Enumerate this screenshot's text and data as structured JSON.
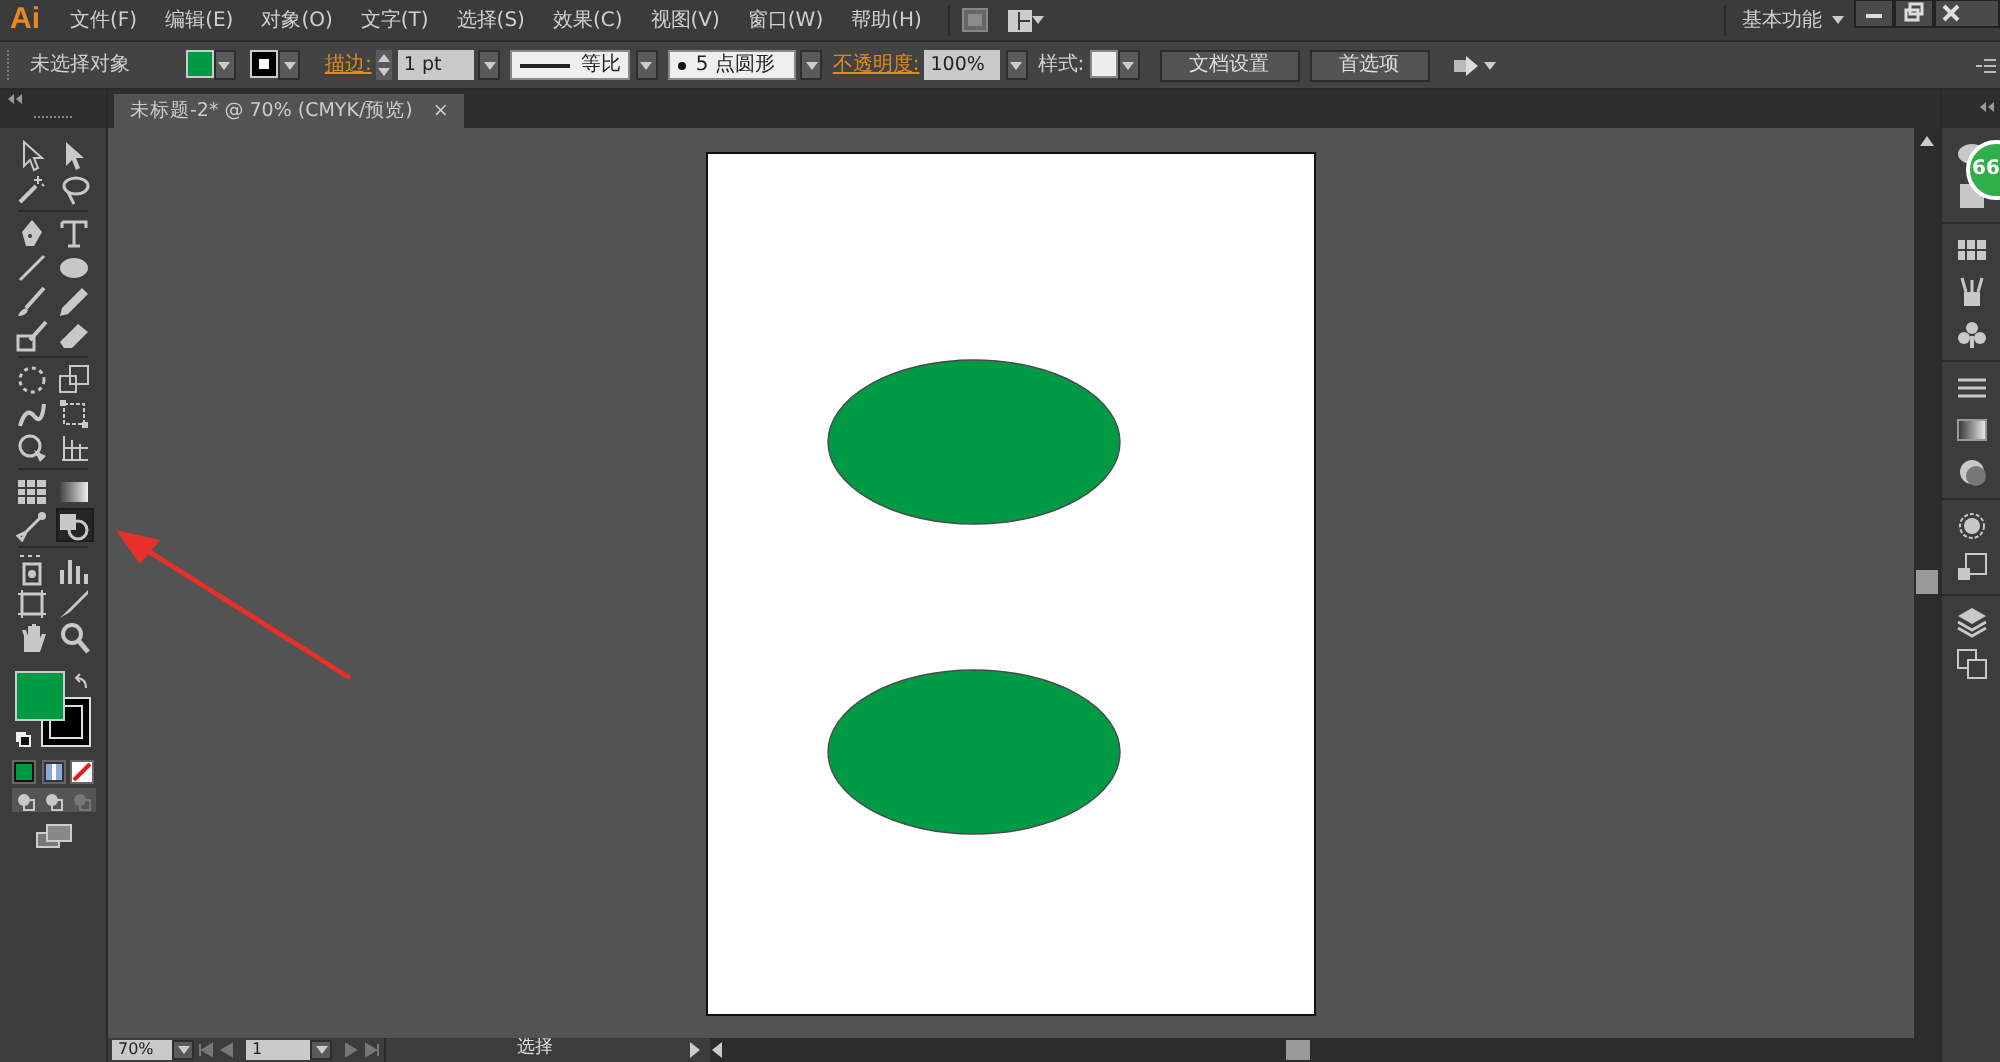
{
  "app": {
    "logo": "Ai"
  },
  "menu": [
    {
      "label": "文件(F)"
    },
    {
      "label": "编辑(E)"
    },
    {
      "label": "对象(O)"
    },
    {
      "label": "文字(T)"
    },
    {
      "label": "选择(S)"
    },
    {
      "label": "效果(C)"
    },
    {
      "label": "视图(V)"
    },
    {
      "label": "窗口(W)"
    },
    {
      "label": "帮助(H)"
    }
  ],
  "workspace": {
    "label": "基本功能"
  },
  "control_bar": {
    "selection": "未选择对象",
    "stroke_label": "描边:",
    "stroke_weight": "1 pt",
    "profile": "等比",
    "brush": "5 点圆形",
    "opacity_label": "不透明度:",
    "opacity": "100%",
    "style_label": "样式:",
    "buttons": [
      "文档设置",
      "首选项"
    ]
  },
  "document_tab": {
    "title": "未标题-2* @ 70% (CMYK/预览)",
    "close": "×"
  },
  "tools": [
    {
      "selected": false
    },
    {
      "selected": false
    },
    {
      "selected": false
    },
    {
      "selected": false
    },
    {
      "selected": false
    },
    {
      "selected": false
    },
    {
      "selected": false
    },
    {
      "selected": false
    },
    {
      "selected": false
    },
    {
      "selected": false
    },
    {
      "selected": false
    },
    {
      "selected": false
    },
    {
      "selected": false
    },
    {
      "selected": false
    },
    {
      "selected": false
    },
    {
      "selected": false
    },
    {
      "selected": false
    },
    {
      "selected": false
    },
    {
      "selected": false
    },
    {
      "selected": false
    },
    {
      "selected": false
    },
    {
      "selected": true
    },
    {
      "selected": false
    },
    {
      "selected": false
    },
    {
      "selected": false
    },
    {
      "selected": false
    },
    {
      "selected": false
    },
    {
      "selected": false
    }
  ],
  "artboard": {
    "shapes": [
      {
        "kind": "ellipse"
      },
      {
        "kind": "ellipse"
      }
    ]
  },
  "status_bar": {
    "zoom": "70%",
    "artboard": "1",
    "tool": "选择"
  },
  "badge": {
    "text": "66"
  }
}
